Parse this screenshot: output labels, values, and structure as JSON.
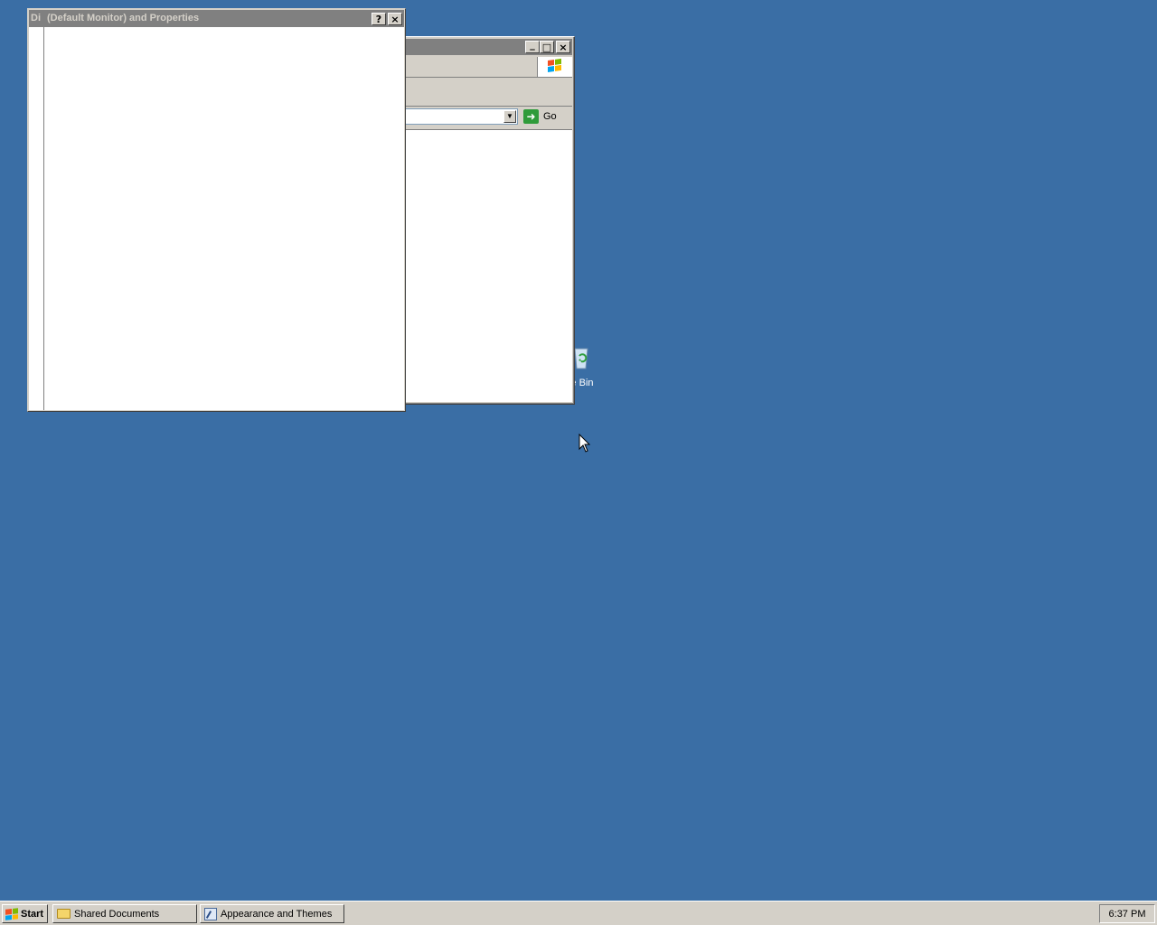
{
  "desktop": {
    "background_color": "#3a6ea5",
    "icons": [
      {
        "label": "cle Bin",
        "icon": "recycle-bin-icon"
      }
    ]
  },
  "windows": {
    "display_properties": {
      "title_prefix": "Di",
      "title": "(Default Monitor) and  Properties",
      "help_label": "?",
      "close_label": "×"
    },
    "appearance_explorer": {
      "minimize_label": "_",
      "maximize_label": "□",
      "close_label": "×",
      "go_label": "Go",
      "address_value": ""
    }
  },
  "taskbar": {
    "start_label": "Start",
    "tasks": [
      {
        "label": "Shared Documents",
        "icon": "folder-icon"
      },
      {
        "label": "Appearance and Themes",
        "icon": "control-panel-icon"
      }
    ],
    "clock": "6:37 PM"
  },
  "colors": {
    "inactive_titlebar": "#808080",
    "face": "#d4d0c8",
    "go_green": "#2f9b3a"
  }
}
